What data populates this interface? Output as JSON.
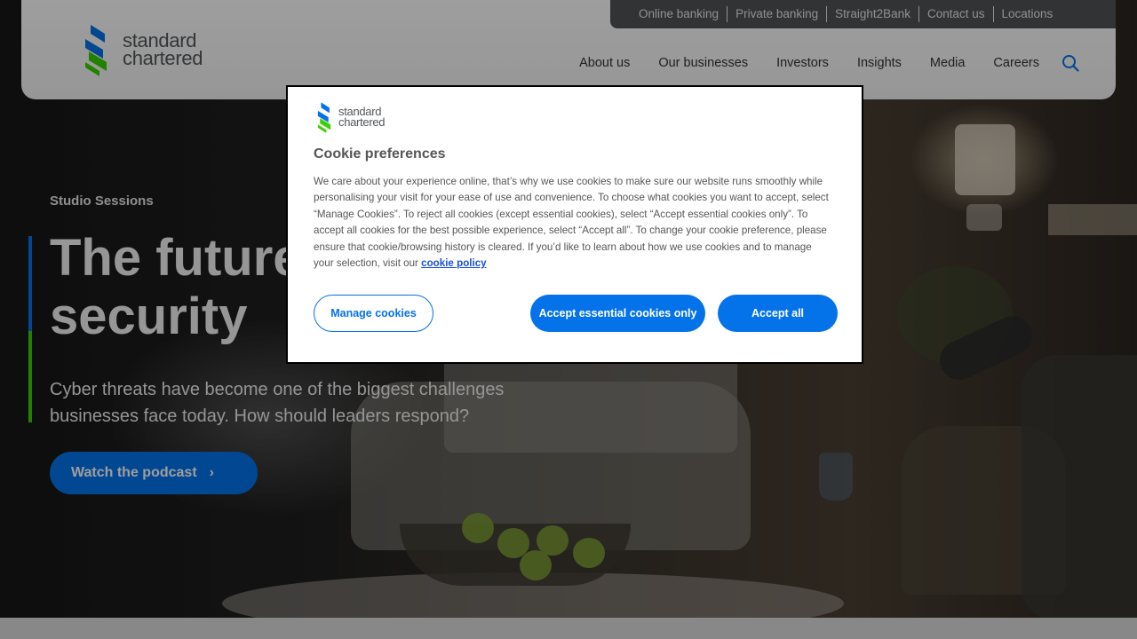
{
  "brand": {
    "name_line1": "standard",
    "name_line2": "chartered",
    "colors": {
      "blue": "#0473ea",
      "green": "#38d200"
    }
  },
  "utility_nav": [
    "Online banking",
    "Private banking",
    "Straight2Bank",
    "Contact us",
    "Locations"
  ],
  "main_nav": [
    "About us",
    "Our businesses",
    "Investors",
    "Insights",
    "Media",
    "Careers"
  ],
  "search": {
    "icon": "search-icon"
  },
  "hero": {
    "eyebrow": "Studio Sessions",
    "title": "The future of security",
    "subtitle": "Cyber threats have become one of the biggest challenges businesses face today. How should leaders respond?",
    "cta_label": "Watch the podcast",
    "cta_icon": "chevron-right-icon"
  },
  "cookie_dialog": {
    "title": "Cookie preferences",
    "body": "We care about your experience online, that’s why we use cookies to make sure our website runs smoothly while personalising your visit for your ease of use and convenience. To choose what cookies you want to accept, select “Manage Cookies”. To reject all cookies (except essential cookies), select “Accept essential cookies only”. To accept all cookies for the best possible experience, select “Accept all”. To change your cookie preference, please ensure that cookie/browsing history is cleared. If you’d like to learn about how we use cookies and to manage your selection, visit our",
    "link_label": "cookie policy",
    "buttons": {
      "manage": "Manage cookies",
      "essential": "Accept essential cookies only",
      "accept_all": "Accept all"
    }
  }
}
